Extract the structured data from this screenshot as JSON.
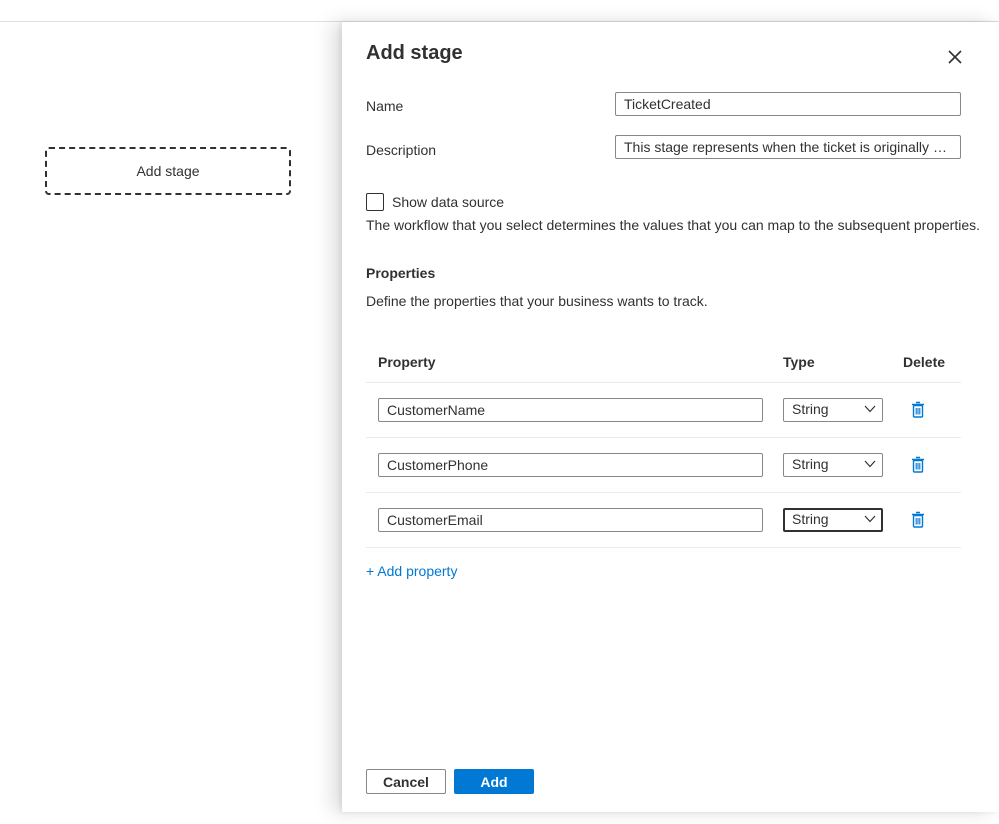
{
  "canvas": {
    "placeholder_label": "Add stage"
  },
  "panel": {
    "title": "Add stage",
    "name_label": "Name",
    "name_value": "TicketCreated",
    "description_label": "Description",
    "description_value": "This stage represents when the ticket is originally creat...",
    "show_data_source_label": "Show data source",
    "show_data_source_checked": false,
    "help_text": "The workflow that you select determines the values that you can map to the subsequent properties.",
    "properties_title": "Properties",
    "properties_desc": "Define the properties that your business wants to track.",
    "table": {
      "headers": {
        "property": "Property",
        "type": "Type",
        "delete": "Delete"
      },
      "rows": [
        {
          "property": "CustomerName",
          "type": "String"
        },
        {
          "property": "CustomerPhone",
          "type": "String"
        },
        {
          "property": "CustomerEmail",
          "type": "String"
        }
      ]
    },
    "add_property_label": "+ Add property",
    "cancel_label": "Cancel",
    "add_label": "Add"
  },
  "colors": {
    "accent": "#0078d4",
    "text": "#323130",
    "border": "#8a8886"
  },
  "icons": {
    "close": "close-icon",
    "chevron": "chevron-down-icon",
    "delete": "trash-icon"
  }
}
